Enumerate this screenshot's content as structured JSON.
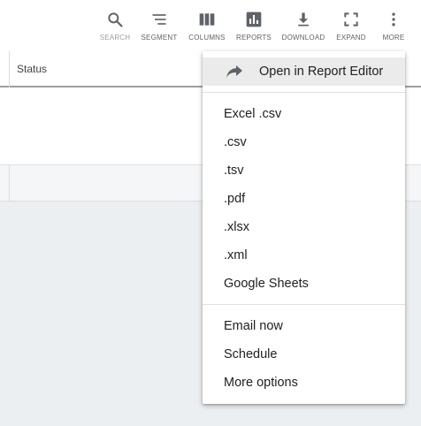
{
  "toolbar": {
    "search": "SEARCH",
    "segment": "SEGMENT",
    "columns": "COLUMNS",
    "reports": "REPORTS",
    "download": "DOWNLOAD",
    "expand": "EXPAND",
    "more": "MORE"
  },
  "table": {
    "status_header": "Status"
  },
  "menu": {
    "open_editor": "Open in Report Editor",
    "formats": [
      "Excel .csv",
      ".csv",
      ".tsv",
      ".pdf",
      ".xlsx",
      ".xml",
      "Google Sheets"
    ],
    "actions": [
      "Email now",
      "Schedule",
      "More options"
    ]
  },
  "icons": {
    "search": "search-icon",
    "segment": "segment-icon",
    "columns": "columns-icon",
    "reports": "reports-icon",
    "download": "download-icon",
    "expand": "expand-icon",
    "more": "more-vert-icon",
    "open_editor": "share-arrow-icon"
  },
  "colors": {
    "icon": "#5f6368",
    "disabled": "#9aa0a6",
    "page_background": "#eceff1",
    "menu_highlight": "#ebebeb"
  }
}
